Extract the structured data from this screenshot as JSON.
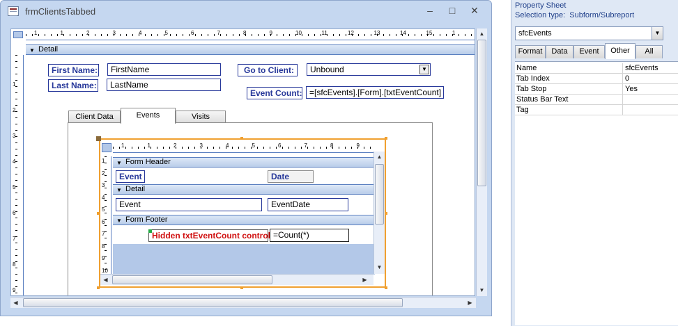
{
  "window": {
    "title": "frmClientsTabbed",
    "minimize": "–",
    "maximize": "□",
    "close": "✕"
  },
  "main_ruler": [
    "1",
    "1",
    "2",
    "3",
    "4",
    "5",
    "6",
    "7",
    "8",
    "9",
    "10",
    "11",
    "12",
    "13",
    "14",
    "15",
    "1"
  ],
  "main_vruler": [
    "1",
    "2",
    "3",
    "4",
    "5",
    "6",
    "7",
    "8",
    "9"
  ],
  "detail_section": "Detail",
  "fields": {
    "first_name_label": "First Name:",
    "first_name_value": "FirstName",
    "last_name_label": "Last Name:",
    "last_name_value": "LastName",
    "go_to_client_label": "Go to Client:",
    "go_to_client_value": "Unbound",
    "event_count_label": "Event Count:",
    "event_count_value": "=[sfcEvents].[Form].[txtEventCount]"
  },
  "tabs": [
    "Client Data",
    "Events",
    "Visits"
  ],
  "active_tab": "Events",
  "subform": {
    "ruler": [
      "1",
      "1",
      "2",
      "3",
      "4",
      "5",
      "6",
      "7",
      "8",
      "9"
    ],
    "vruler": [
      "1",
      "2",
      "3",
      "4",
      "5",
      "6",
      "7",
      "8",
      "9",
      "10"
    ],
    "header_section": "Form Header",
    "header_event_label": "Event",
    "header_date_label": "Date",
    "detail_section": "Detail",
    "event_value": "Event",
    "event_date_value": "EventDate",
    "footer_section": "Form Footer",
    "hidden_label": "Hidden txtEventCount control:",
    "count_value": "=Count(*)"
  },
  "property_sheet": {
    "title": "Property Sheet",
    "selection_type_label": "Selection type:",
    "selection_type": "Subform/Subreport",
    "selected_object": "sfcEvents",
    "tabs": [
      "Format",
      "Data",
      "Event",
      "Other",
      "All"
    ],
    "active_tab": "Other",
    "rows": [
      {
        "name": "Name",
        "value": "sfcEvents"
      },
      {
        "name": "Tab Index",
        "value": "0"
      },
      {
        "name": "Tab Stop",
        "value": "Yes"
      },
      {
        "name": "Status Bar Text",
        "value": ""
      },
      {
        "name": "Tag",
        "value": ""
      }
    ]
  },
  "colors": {
    "label_text": "#27389a",
    "hidden_label_text": "#d01010",
    "selection_border": "#f0a030",
    "property_sheet_title": "#1f3f8a"
  }
}
